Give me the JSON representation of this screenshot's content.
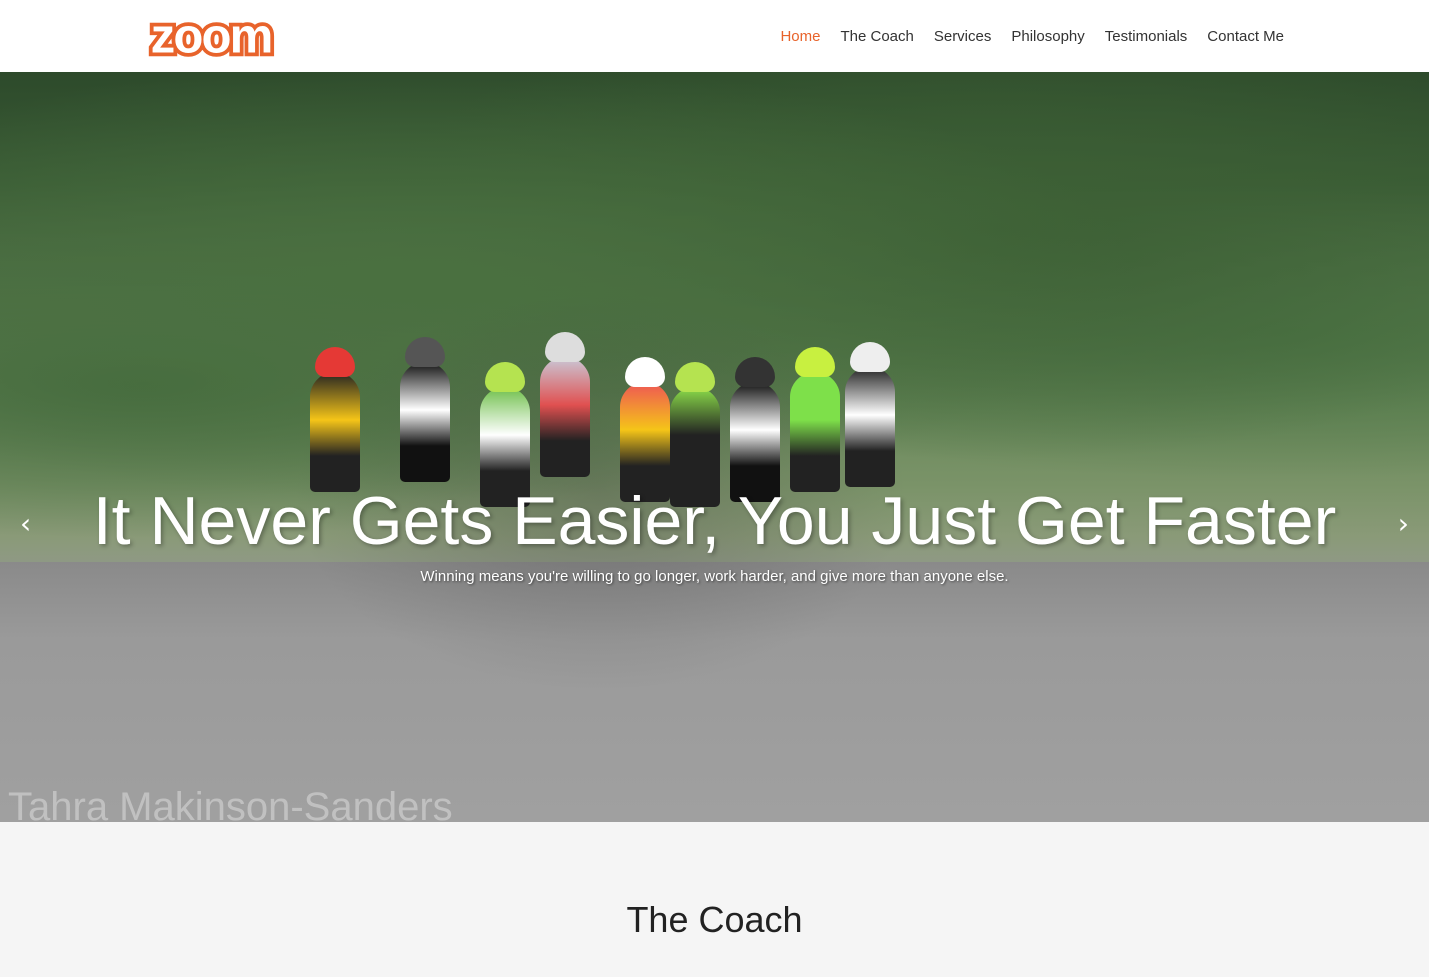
{
  "header": {
    "logo_text": "zoom",
    "nav": [
      {
        "label": "Home",
        "active": true
      },
      {
        "label": "The Coach",
        "active": false
      },
      {
        "label": "Services",
        "active": false
      },
      {
        "label": "Philosophy",
        "active": false
      },
      {
        "label": "Testimonials",
        "active": false
      },
      {
        "label": "Contact Me",
        "active": false
      }
    ]
  },
  "hero": {
    "title": "It Never Gets Easier, You Just Get Faster",
    "subtitle": "Winning means you're willing to go longer, work harder, and give more than anyone else.",
    "watermark": "Tahra Makinson-Sanders",
    "arrow_left": "‹",
    "arrow_right": "›"
  },
  "section": {
    "title": "The Coach"
  },
  "colors": {
    "accent": "#e8632b",
    "nav_text": "#333333"
  }
}
